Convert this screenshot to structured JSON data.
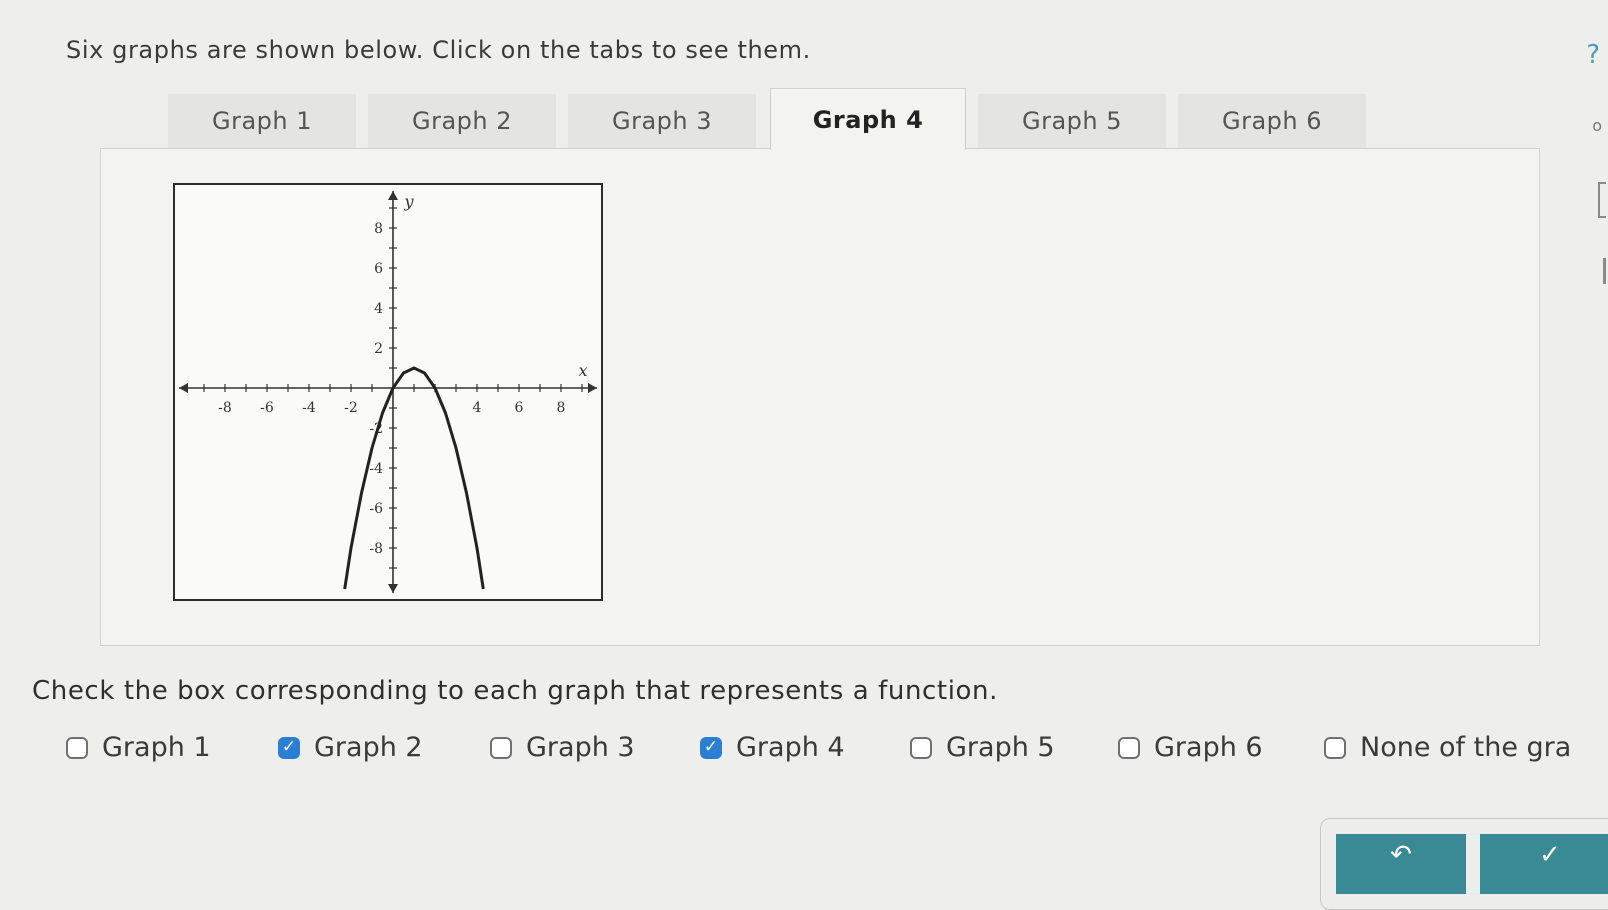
{
  "prompt": "Six graphs are shown below. Click on the tabs to see them.",
  "help_glyph": "?",
  "tabs": [
    {
      "label": "Graph 1",
      "active": false
    },
    {
      "label": "Graph 2",
      "active": false
    },
    {
      "label": "Graph 3",
      "active": false
    },
    {
      "label": "Graph 4",
      "active": true
    },
    {
      "label": "Graph 5",
      "active": false
    },
    {
      "label": "Graph 6",
      "active": false
    }
  ],
  "chart_data": {
    "type": "line",
    "title": "",
    "xlabel": "x",
    "ylabel": "y",
    "xlim": [
      -10,
      10
    ],
    "ylim": [
      -10,
      10
    ],
    "x_ticks": [
      -8,
      -6,
      -4,
      -2,
      2,
      4,
      6,
      8
    ],
    "y_ticks": [
      -8,
      -6,
      -4,
      -2,
      2,
      4,
      6,
      8
    ],
    "x_tick_labels": [
      "-8",
      "-6",
      "-4",
      "-2",
      "4",
      "6",
      "8"
    ],
    "y_tick_labels": [
      "8",
      "6",
      "4",
      "2",
      "-2",
      "-4",
      "-6",
      "-8"
    ],
    "grid": false,
    "series": [
      {
        "x": [
          -2.3,
          -2,
          -1.5,
          -1,
          -0.5,
          0,
          0.5,
          1,
          1.5,
          2,
          2.5,
          3,
          3.5,
          4,
          4.3
        ],
        "y": [
          -10.05,
          -8,
          -5.25,
          -3,
          -1.25,
          0,
          0.75,
          1,
          0.75,
          0,
          -1.25,
          -3,
          -5.25,
          -8,
          -10.05
        ]
      }
    ]
  },
  "instruction": "Check the box corresponding to each graph that represents a function.",
  "options": [
    {
      "label": "Graph 1",
      "checked": false
    },
    {
      "label": "Graph 2",
      "checked": true
    },
    {
      "label": "Graph 3",
      "checked": false
    },
    {
      "label": "Graph 4",
      "checked": true
    },
    {
      "label": "Graph 5",
      "checked": false
    },
    {
      "label": "Graph 6",
      "checked": false
    },
    {
      "label": "None of the gra",
      "checked": false
    }
  ],
  "buttons": {
    "undo_icon": "undo-icon",
    "check_icon": "check-icon"
  }
}
